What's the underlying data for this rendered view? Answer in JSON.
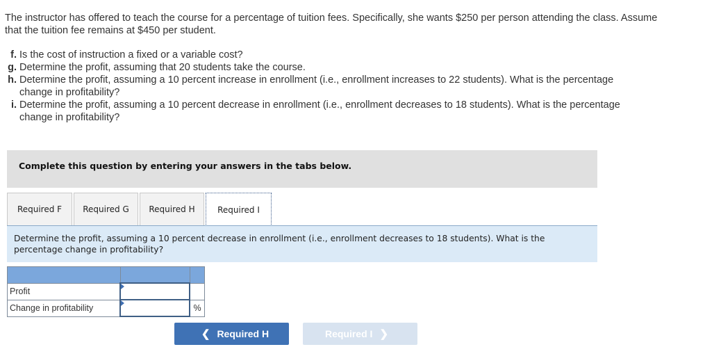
{
  "intro": {
    "text": "The instructor has offered to teach the course for a percentage of tuition fees. Specifically, she wants $250 per person attending the class. Assume that the tuition fee remains at $450 per student."
  },
  "questions": [
    {
      "letter": "f.",
      "text": "Is the cost of instruction a fixed or a variable cost?"
    },
    {
      "letter": "g.",
      "text": "Determine the profit, assuming that 20 students take the course."
    },
    {
      "letter": "h.",
      "text": "Determine the profit, assuming a 10 percent increase in enrollment (i.e., enrollment increases to 22 students). What is the percentage change in profitability?"
    },
    {
      "letter": "i.",
      "text": "Determine the profit, assuming a 10 percent decrease in enrollment (i.e., enrollment decreases to 18 students). What is the percentage change in profitability?"
    }
  ],
  "banner": {
    "text": "Complete this question by entering your answers in the tabs below."
  },
  "tabs": [
    {
      "label": "Required F",
      "active": false
    },
    {
      "label": "Required G",
      "active": false
    },
    {
      "label": "Required H",
      "active": false
    },
    {
      "label": "Required I",
      "active": true
    }
  ],
  "prompt": {
    "text": "Determine the profit, assuming a 10 percent decrease in enrollment (i.e., enrollment decreases to 18 students). What is the percentage change in profitability?"
  },
  "answer_table": {
    "rows": [
      {
        "label": "Profit",
        "value": "",
        "unit": ""
      },
      {
        "label": "Change in profitability",
        "value": "",
        "unit": "%"
      }
    ]
  },
  "nav": {
    "prev_label": "Required H",
    "next_label": "Required I",
    "prev_icon": "chevron-left-icon",
    "next_icon": "chevron-right-icon"
  },
  "colors": {
    "primary_button": "#3f72b5",
    "disabled_button": "#d8e3f0",
    "table_header": "#7ba7dc",
    "prompt_bg": "#dbeaf7",
    "banner_bg": "#e0e0e0"
  }
}
